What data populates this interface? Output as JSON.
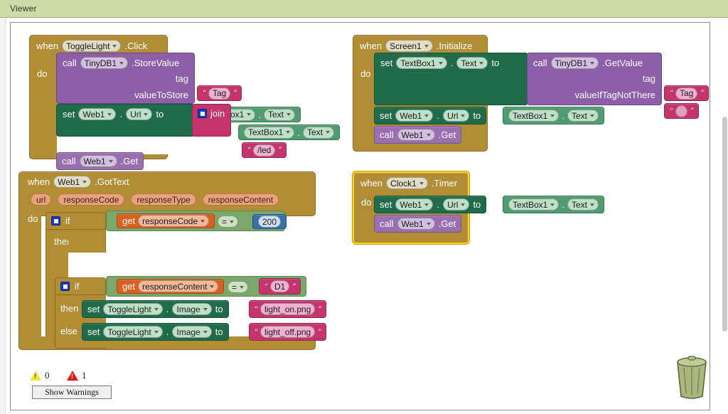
{
  "header": {
    "title": "Viewer"
  },
  "workspace": {
    "warnings": {
      "warning_count": "0",
      "error_count": "1",
      "show_warnings_label": "Show Warnings",
      "warning_icon": "warning-triangle-icon",
      "error_icon": "error-triangle-icon"
    },
    "trash_icon": "trash-can-icon",
    "scrollbar": "vertical-scrollbar"
  },
  "blocks": {
    "toggle_click": {
      "when": "when",
      "component": "ToggleLight",
      "event": ".Click",
      "do": "do",
      "call": "call",
      "tinydb": "TinyDB1",
      "store_method": ".StoreValue",
      "tag_label": "tag",
      "tag_value": "Tag",
      "valuetostore_label": "valueToStore",
      "textbox": "TextBox1",
      "dot": ".",
      "text_prop": "Text",
      "set": "set",
      "web": "Web1",
      "url_prop": "Url",
      "to": "to",
      "join": "join",
      "join_text": "/led",
      "call2": "call",
      "get_method": ".Get"
    },
    "screen_init": {
      "when": "when",
      "component": "Screen1",
      "event": ".Initialize",
      "do": "do",
      "set": "set",
      "textbox": "TextBox1",
      "dot": ".",
      "text_prop": "Text",
      "to": "to",
      "call": "call",
      "tinydb": "TinyDB1",
      "get_method": ".GetValue",
      "tag_label": "tag",
      "tag_value": "Tag",
      "valueiftag_label": "valueIfTagNotThere",
      "valueiftag_value": "",
      "set2": "set",
      "web": "Web1",
      "url_prop": "Url",
      "call2": "call",
      "webget_method": ".Get"
    },
    "web_gottext": {
      "when": "when",
      "component": "Web1",
      "event": ".GotText",
      "params": [
        "url",
        "responseCode",
        "responseType",
        "responseContent"
      ],
      "do": "do",
      "if": "if",
      "then": "then",
      "else": "else",
      "get": "get",
      "response_code": "responseCode",
      "eq": "=",
      "code_value": "200",
      "get2": "get",
      "response_content": "responseContent",
      "eq2": "=",
      "content_value": "D1",
      "set": "set",
      "togglelight": "ToggleLight",
      "dot": ".",
      "image_prop": "Image",
      "to": "to",
      "image_on": "light_on.png",
      "image_off": "light_off.png"
    },
    "clock_timer": {
      "when": "when",
      "component": "Clock1",
      "event": ".Timer",
      "do": "do",
      "set": "set",
      "web": "Web1",
      "dot": ".",
      "url_prop": "Url",
      "to": "to",
      "textbox": "TextBox1",
      "text_prop": "Text",
      "call": "call",
      "web2": "Web1",
      "get_method": ".Get"
    }
  },
  "colors": {
    "header_bg": "#cddca5",
    "event_block": "#b18e35",
    "control_block": "#b18e35",
    "component_set": "#1f6b4a",
    "component_call": "#8c5fa8",
    "text_block": "#c4356b",
    "getter_block": "#60a65c",
    "variable_get": "#d9601f",
    "logic_block": "#7aa86a",
    "math_block": "#3b6fa8",
    "selection_highlight": "#ffd21e"
  }
}
